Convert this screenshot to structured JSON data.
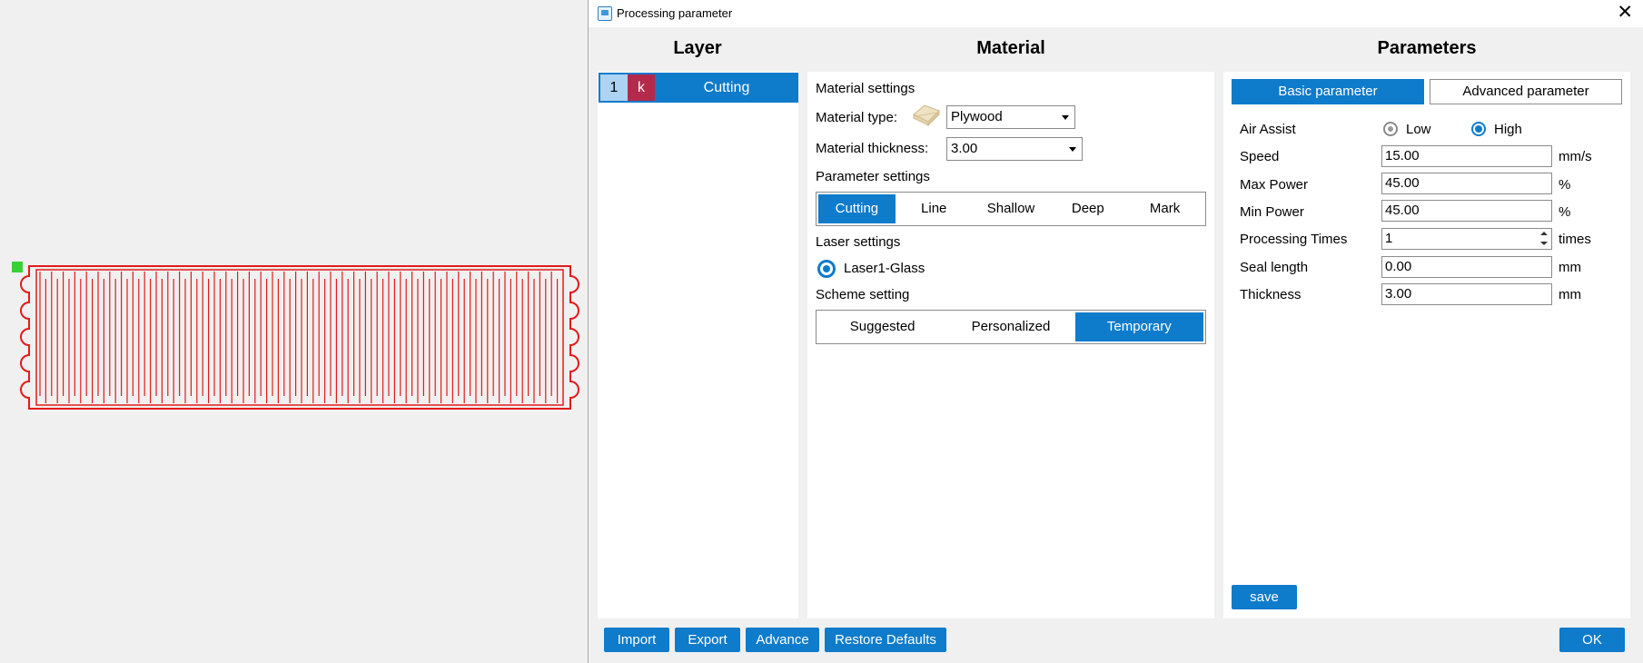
{
  "dialog": {
    "title": "Processing parameter",
    "close_glyph": "✕"
  },
  "columns": {
    "layer": "Layer",
    "material": "Material",
    "parameters": "Parameters"
  },
  "layer": {
    "number": "1",
    "mode": "k",
    "name": "Cutting",
    "color": "#b42a4b"
  },
  "material": {
    "material_settings_label": "Material settings",
    "material_type_label": "Material type:",
    "material_type_value": "Plywood",
    "material_thickness_label": "Material thickness:",
    "material_thickness_value": "3.00",
    "parameter_settings_label": "Parameter settings",
    "parameter_tabs": [
      "Cutting",
      "Line",
      "Shallow",
      "Deep",
      "Mark"
    ],
    "parameter_active": "Cutting",
    "laser_settings_label": "Laser settings",
    "laser_name": "Laser1-Glass",
    "scheme_setting_label": "Scheme setting",
    "scheme_tabs": [
      "Suggested",
      "Personalized",
      "Temporary"
    ],
    "scheme_active": "Temporary"
  },
  "parameters": {
    "basic_tab": "Basic parameter",
    "advanced_tab": "Advanced parameter",
    "air_assist_label": "Air Assist",
    "air_low": "Low",
    "air_high": "High",
    "air_selected": "High",
    "speed_label": "Speed",
    "speed_value": "15.00",
    "speed_unit": "mm/s",
    "max_power_label": "Max Power",
    "max_power_value": "45.00",
    "max_power_unit": "%",
    "min_power_label": "Min Power",
    "min_power_value": "45.00",
    "min_power_unit": "%",
    "times_label": "Processing Times",
    "times_value": "1",
    "times_unit": "times",
    "seal_label": "Seal length",
    "seal_value": "0.00",
    "seal_unit": "mm",
    "thickness_label": "Thickness",
    "thickness_value": "3.00",
    "thickness_unit": "mm",
    "save_label": "save"
  },
  "footer": {
    "import_label": "Import",
    "export_label": "Export",
    "advance_label": "Advance",
    "restore_label": "Restore Defaults",
    "ok_label": "OK"
  },
  "colors": {
    "accent": "#0f7bcb",
    "cut_line": "#e31b1b",
    "handle": "#37d137"
  },
  "icons": {
    "app": "app-icon",
    "close": "close-icon",
    "material_swatch": "plywood-swatch-icon",
    "dropdown": "chevron-down-icon"
  }
}
